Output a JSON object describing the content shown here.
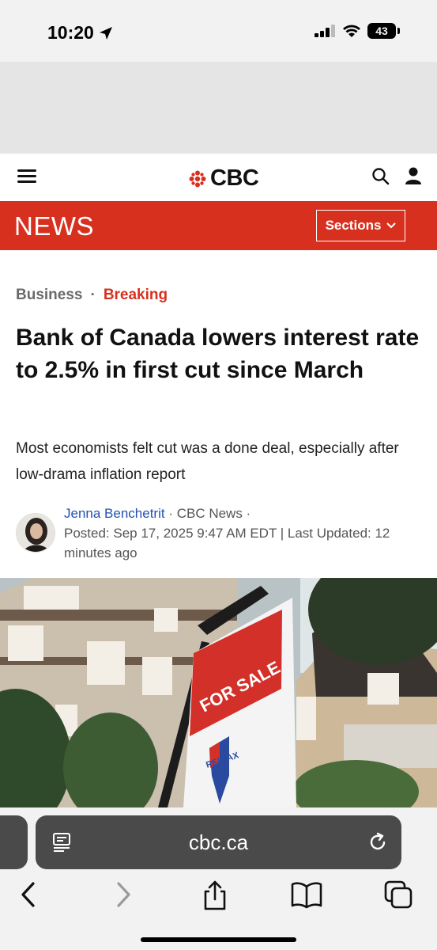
{
  "status_bar": {
    "time": "10:20",
    "battery": "43"
  },
  "header": {
    "logo_text": "CBC",
    "section_name": "NEWS",
    "sections_label": "Sections"
  },
  "article": {
    "category": "Business",
    "tag": "Breaking",
    "headline": "Bank of Canada lowers interest rate to 2.5% in first cut since March",
    "deck": "Most economists felt cut was a done deal, especially after low-drama inflation report",
    "author": "Jenna Benchetrit",
    "source": "· CBC News ·",
    "posted": "Posted: Sep 17, 2025 9:47 AM EDT | Last Updated: 12 minutes ago",
    "photo_sign_text": "FOR SALE",
    "photo_brand": "RE/MAX"
  },
  "browser": {
    "url": "cbc.ca"
  },
  "colors": {
    "cbc_red": "#d7301f",
    "author_link": "#2250b0",
    "address_bar": "#4a4a4a"
  }
}
